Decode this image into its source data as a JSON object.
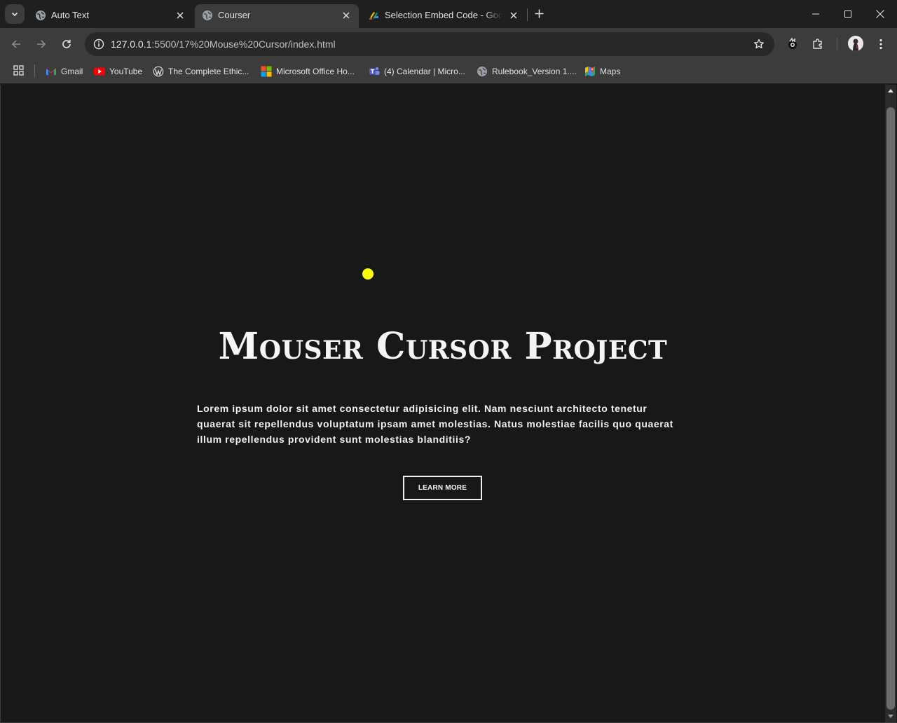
{
  "tabs": [
    {
      "title": "Auto Text",
      "favicon": "globe-icon",
      "active": false
    },
    {
      "title": "Courser",
      "favicon": "globe-icon",
      "active": true
    },
    {
      "title": "Selection Embed Code - Google",
      "favicon": "google-apps-script-icon",
      "active": false
    }
  ],
  "address_bar": {
    "host": "127.0.0.1",
    "path": ":5500/17%20Mouse%20Cursor/index.html"
  },
  "bookmarks": [
    {
      "label": "Gmail",
      "icon": "gmail-icon"
    },
    {
      "label": "YouTube",
      "icon": "youtube-icon"
    },
    {
      "label": "The Complete Ethic...",
      "icon": "wordpress-icon"
    },
    {
      "label": "Microsoft Office Ho...",
      "icon": "microsoft-icon"
    },
    {
      "label": "(4) Calendar | Micro...",
      "icon": "teams-icon"
    },
    {
      "label": "Rulebook_Version 1....",
      "icon": "globe-icon"
    },
    {
      "label": "Maps",
      "icon": "maps-icon"
    }
  ],
  "page": {
    "title": "Mouser Cursor Project",
    "body": "Lorem ipsum dolor sit amet consectetur adipisicing elit. Nam nesciunt architecto tenetur quaerat sit repellendus voluptatum ipsam amet molestias. Natus molestiae facilis quo quaerat illum repellendus provident sunt molestias blanditiis?",
    "button_label": "LEARN MORE",
    "background_color": "#181818",
    "cursor_color": "#ffff00"
  }
}
